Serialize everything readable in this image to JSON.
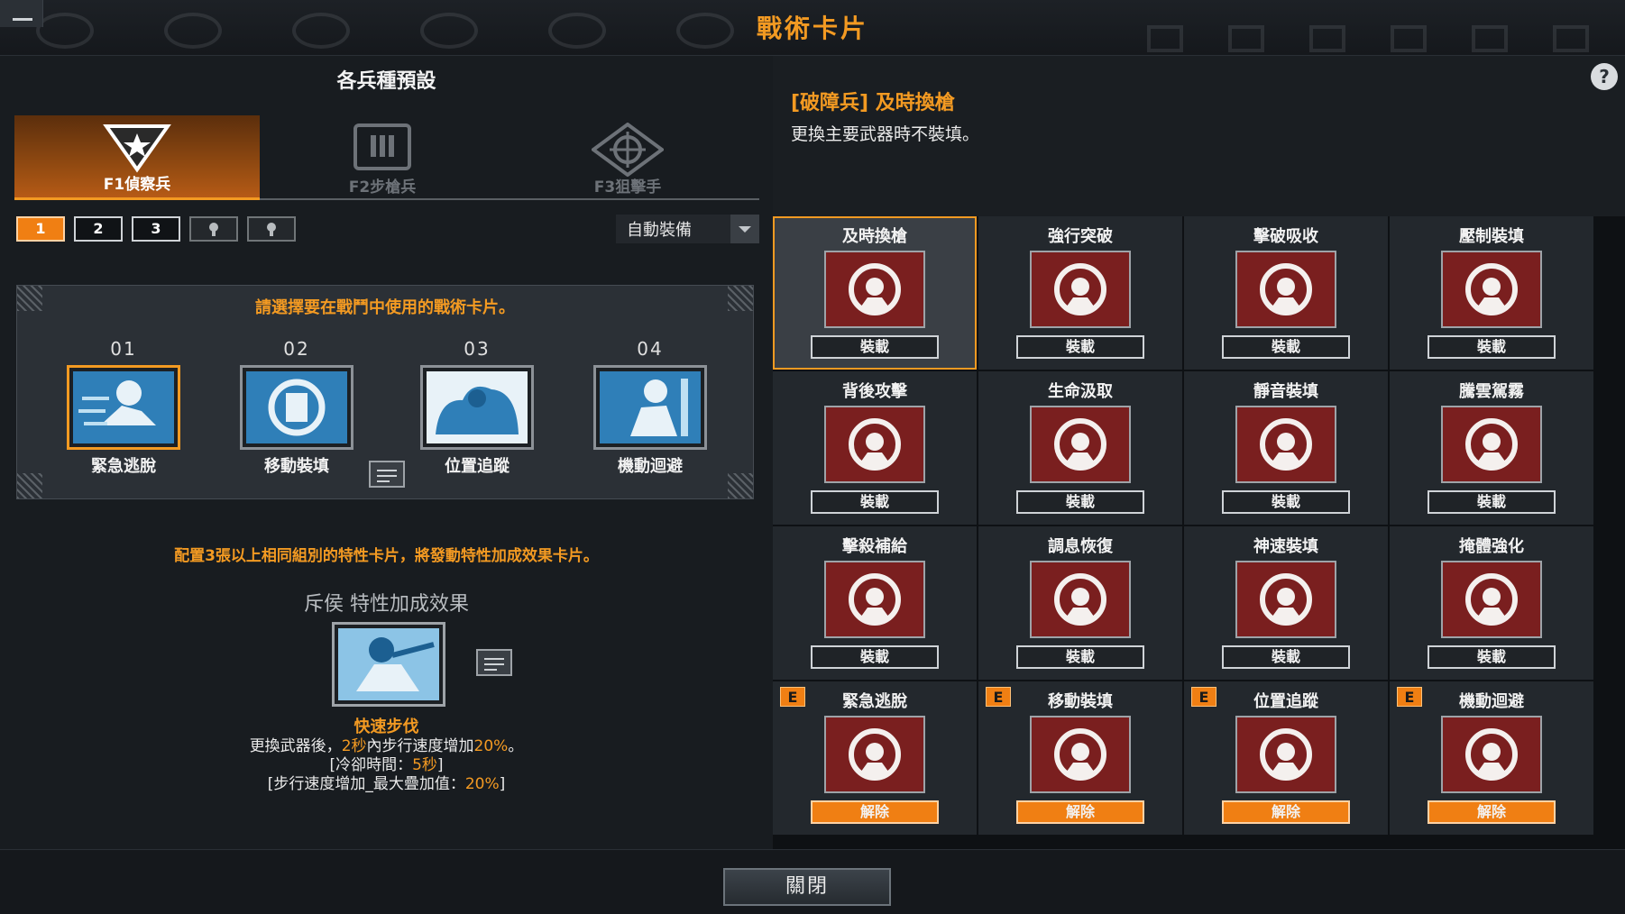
{
  "window": {
    "title": "戰術卡片"
  },
  "left": {
    "title": "各兵種預設",
    "class_tabs": [
      {
        "label": "F1偵察兵",
        "icon": "scout-star-icon",
        "active": true
      },
      {
        "label": "F2步槍兵",
        "icon": "rifleman-ammo-icon",
        "active": false
      },
      {
        "label": "F3狙擊手",
        "icon": "sniper-scope-icon",
        "active": false
      }
    ],
    "loadout_slots": [
      "1",
      "2",
      "3"
    ],
    "auto_equip_label": "自動裝備",
    "selection_prompt": "請選擇要在戰鬥中使用的戰術卡片。",
    "selected_cards": [
      {
        "num": "01",
        "name": "緊急逃脫"
      },
      {
        "num": "02",
        "name": "移動裝填"
      },
      {
        "num": "03",
        "name": "位置追蹤"
      },
      {
        "num": "04",
        "name": "機動迴避"
      }
    ],
    "bonus_note": "配置3張以上相同組別的特性卡片，將發動特性加成效果卡片。",
    "bonus_title": "斥侯 特性加成效果",
    "bonus_name": "快速步伐",
    "bonus_desc": {
      "line1_a": "更換武器後，",
      "line1_b": "2秒",
      "line1_c": "內步行速度增加",
      "line1_d": "20%",
      "line1_e": "。",
      "line2_a": "[冷卻時間：",
      "line2_b": "5秒",
      "line2_c": "]",
      "line3_a": "[步行速度增加_最大疊加值：",
      "line3_b": "20%",
      "line3_c": "]"
    }
  },
  "right": {
    "help": "?",
    "info_title": "[破障兵] 及時換槍",
    "info_desc": "更換主要武器時不裝填。",
    "cards": [
      {
        "name": "及時換槍",
        "btn": "裝載",
        "color": "red",
        "selected": true
      },
      {
        "name": "強行突破",
        "btn": "裝載",
        "color": "red"
      },
      {
        "name": "擊破吸收",
        "btn": "裝載",
        "color": "red"
      },
      {
        "name": "壓制裝填",
        "btn": "裝載",
        "color": "red"
      },
      {
        "name": "背後攻擊",
        "btn": "裝載",
        "color": "purple"
      },
      {
        "name": "生命汲取",
        "btn": "裝載",
        "color": "purple"
      },
      {
        "name": "靜音裝填",
        "btn": "裝載",
        "color": "purple"
      },
      {
        "name": "騰雲駕霧",
        "btn": "裝載",
        "color": "purple"
      },
      {
        "name": "擊殺補給",
        "btn": "裝載",
        "color": "brown"
      },
      {
        "name": "調息恢復",
        "btn": "裝載",
        "color": "brown"
      },
      {
        "name": "神速裝填",
        "btn": "裝載",
        "color": "brown"
      },
      {
        "name": "掩體強化",
        "btn": "裝載",
        "color": "brown"
      },
      {
        "name": "緊急逃脫",
        "btn": "解除",
        "color": "blue",
        "badge": "E"
      },
      {
        "name": "移動裝填",
        "btn": "解除",
        "color": "blue",
        "badge": "E"
      },
      {
        "name": "位置追蹤",
        "btn": "解除",
        "color": "blue",
        "badge": "E"
      },
      {
        "name": "機動迴避",
        "btn": "解除",
        "color": "blue",
        "badge": "E"
      }
    ]
  },
  "bottom": {
    "close_label": "關閉"
  }
}
